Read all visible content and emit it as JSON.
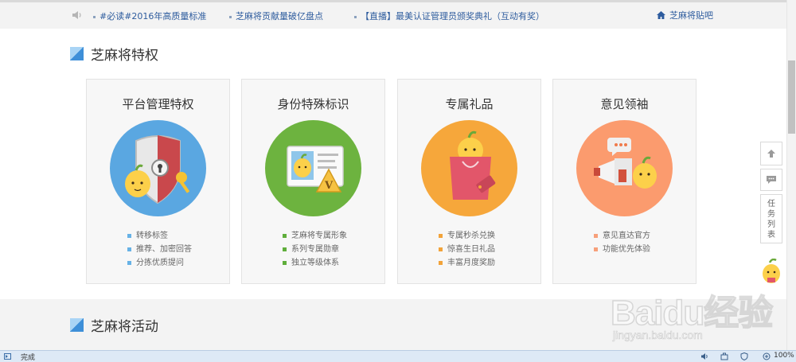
{
  "notice": {
    "items": [
      {
        "text": "#必读#2016年高质量标准"
      },
      {
        "text": "芝麻将贡献量破亿盘点"
      },
      {
        "text": "【直播】最美认证管理员颁奖典礼（互动有奖）"
      }
    ],
    "home_link": "芝麻将贴吧"
  },
  "section1": {
    "title": "芝麻将特权"
  },
  "cards": [
    {
      "title": "平台管理特权",
      "color": "#5aa7e1",
      "bullet": "#67b2e6",
      "items": [
        "转移标签",
        "推荐、加密回答",
        "分拣优质提问"
      ]
    },
    {
      "title": "身份特殊标识",
      "color": "#6db33f",
      "bullet": "#5fae3b",
      "items": [
        "芝麻将专属形象",
        "系列专属勋章",
        "独立等级体系"
      ]
    },
    {
      "title": "专属礼品",
      "color": "#f6a73b",
      "bullet": "#f2a33a",
      "items": [
        "专属秒杀兑换",
        "惊喜生日礼品",
        "丰富月度奖励"
      ]
    },
    {
      "title": "意见领袖",
      "color": "#fb9b6e",
      "bullet": "#f7a07a",
      "items": [
        "意见直达官方",
        "功能优先体验"
      ]
    }
  ],
  "section2": {
    "title": "芝麻将活动"
  },
  "side": {
    "tasks_label": [
      "任",
      "务",
      "列",
      "表"
    ]
  },
  "watermark": {
    "logo": "Baidu经验",
    "url": "jingyan.baidu.com"
  },
  "status": {
    "text": "完成",
    "zoom": "100%"
  }
}
